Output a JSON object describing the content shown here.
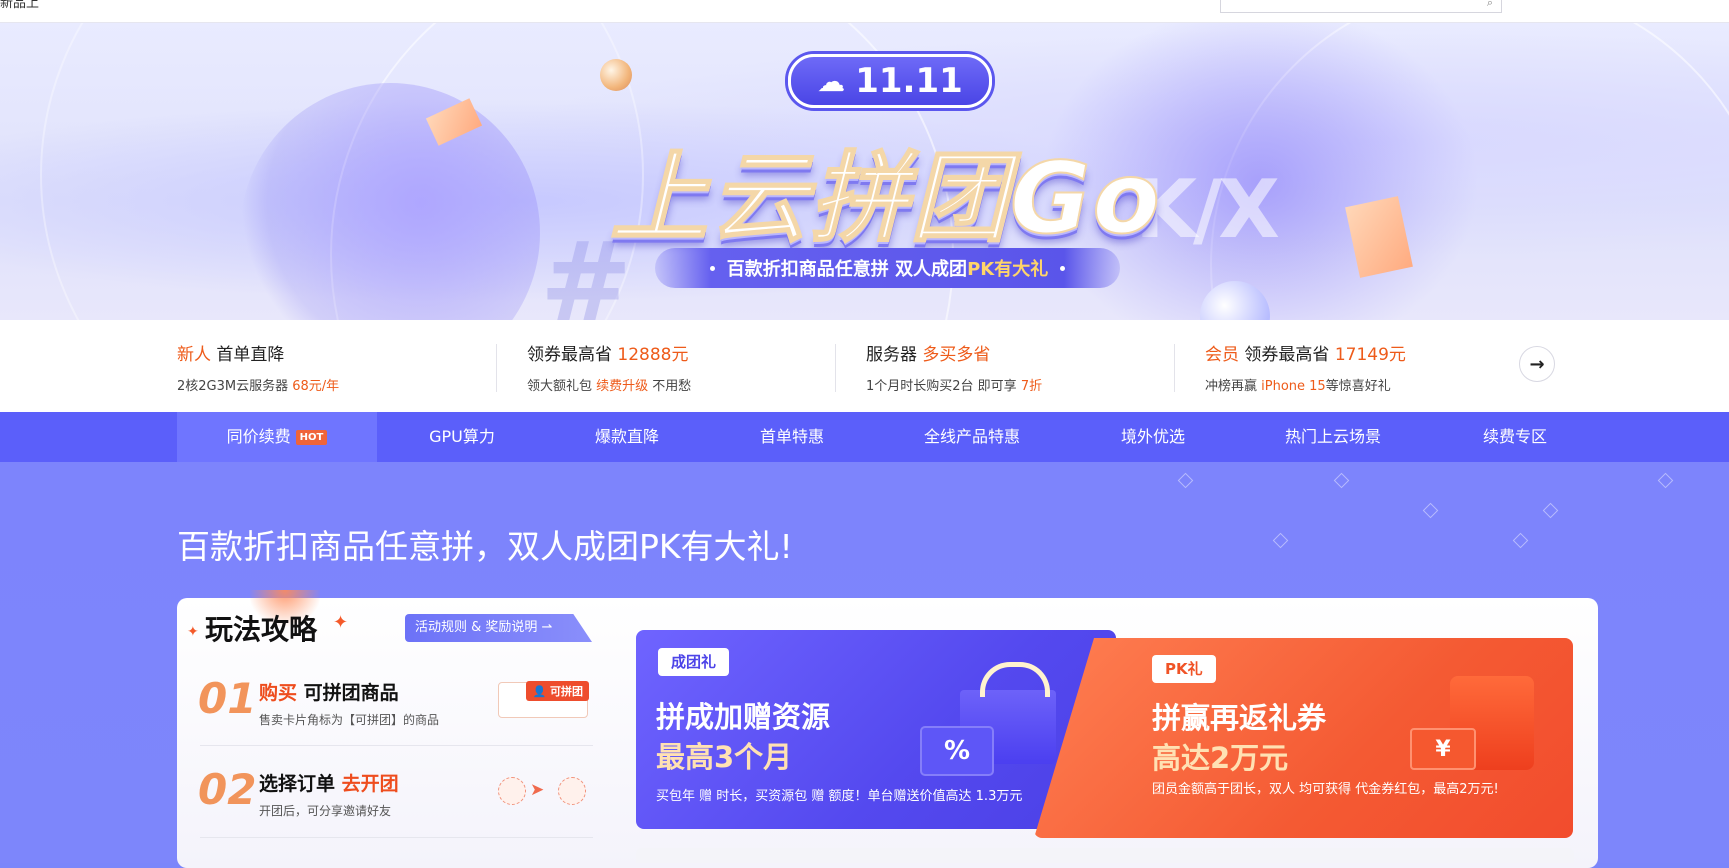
{
  "topbar": {
    "left_text": "新品上",
    "search_placeholder": "",
    "search_icon": "search-icon"
  },
  "hero": {
    "badge": "11.11",
    "headline": "上云拼团Go",
    "ribbon_prefix": "百款折扣商品任意拼  双人成团 ",
    "ribbon_highlight": "PK有大礼"
  },
  "promo": [
    {
      "t1_a": "新人",
      "t1_b": " 首单直降",
      "t2_a": "2核2G3M云服务器 ",
      "t2_b": "68元/年",
      "t2_c": ""
    },
    {
      "t1_a": "领券最高省 ",
      "t1_b": "12888元",
      "t2_a": "领大额礼包 ",
      "t2_b": "续费升级",
      "t2_c": " 不用愁"
    },
    {
      "t1_a": "服务器 ",
      "t1_b": "多买多省",
      "t2_a": "1个月时长购买2台 即可享 ",
      "t2_b": "7折",
      "t2_c": ""
    },
    {
      "t1_a": "会员",
      "t1_b": " 领券最高省 ",
      "t1_c": "17149元",
      "t2_a": "冲榜再赢 ",
      "t2_b": "iPhone 15",
      "t2_c": "等惊喜好礼"
    }
  ],
  "promo_next": "→",
  "tabs": [
    {
      "label": "同价续费",
      "hot": "HOT"
    },
    {
      "label": "GPU算力"
    },
    {
      "label": "爆款直降"
    },
    {
      "label": "首单特惠"
    },
    {
      "label": "全线产品特惠"
    },
    {
      "label": "境外优选"
    },
    {
      "label": "热门上云场景"
    },
    {
      "label": "续费专区"
    }
  ],
  "main": {
    "title": "百款折扣商品任意拼，双人成团PK有大礼!",
    "guide_title": "玩法攻略",
    "rules_link": "活动规则 & 奖励说明 ⇀",
    "steps": [
      {
        "num": "01",
        "h_a": "购买",
        "h_b": " 可拼团商品",
        "d": "售卖卡片角标为【可拼团】的商品",
        "tag": "可拼团"
      },
      {
        "num": "02",
        "h_a": "选择订单 ",
        "h_b": "去开团",
        "d": "开团后，可分享邀请好友"
      }
    ],
    "gift_card": {
      "chip": "成团礼",
      "line1": "拼成加赠资源",
      "line2": "最高3个月",
      "desc": "买包年 赠 时长，买资源包 赠 额度！单台赠送价值高达 1.3万元",
      "pct": "%"
    },
    "pk_card": {
      "chip": "PK礼",
      "line1": "拼赢再返礼券",
      "line2": "高达2万元",
      "desc": "团员金额高于团长，双人 均可获得 代金券红包，最高2万元!",
      "yen": "¥"
    }
  },
  "colors": {
    "accent": "#5b5ffa",
    "orange": "#ee5b1a",
    "pk": "#f45a33",
    "gift": "#5449ef"
  }
}
